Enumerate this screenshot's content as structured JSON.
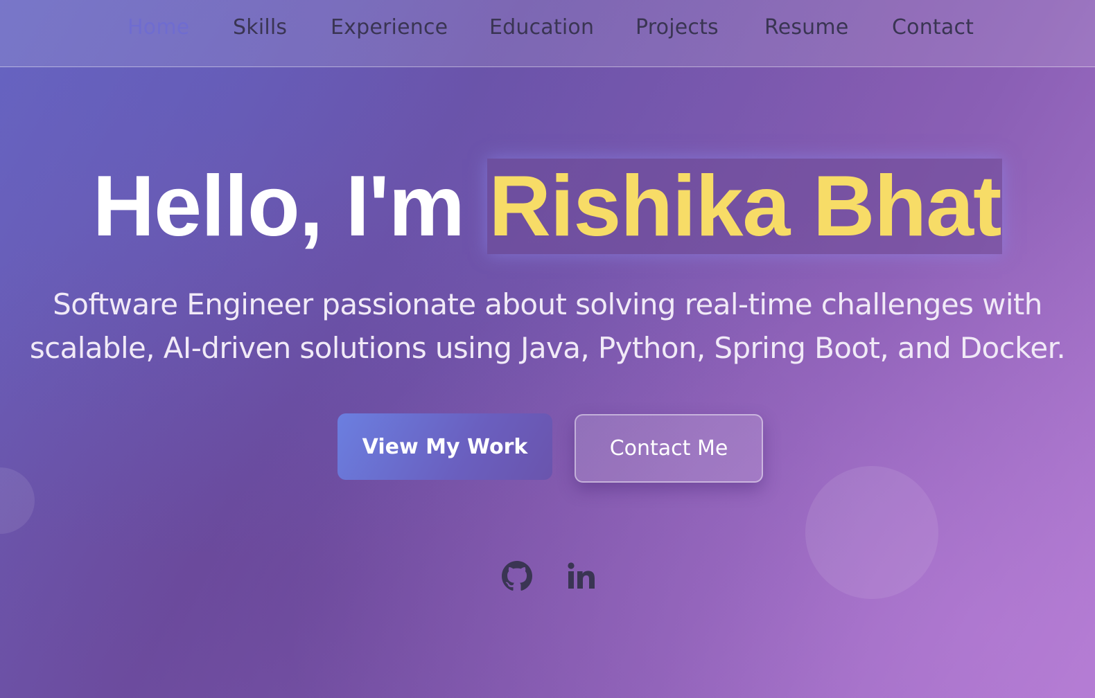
{
  "nav": {
    "items": [
      {
        "label": "Home",
        "active": true
      },
      {
        "label": "Skills",
        "active": false
      },
      {
        "label": "Experience",
        "active": false
      },
      {
        "label": "Education",
        "active": false
      },
      {
        "label": "Projects",
        "active": false
      },
      {
        "label": "Resume",
        "active": false
      },
      {
        "label": "Contact",
        "active": false
      }
    ]
  },
  "hero": {
    "greeting": "Hello, I'm ",
    "name": "Rishika Bhat",
    "subtitle": "Software Engineer passionate about solving real-time challenges with scalable, AI-driven solutions using Java, Python, Spring Boot, and Docker."
  },
  "buttons": {
    "primary": "View My Work",
    "secondary": "Contact Me"
  },
  "social": [
    {
      "icon": "github-icon"
    },
    {
      "icon": "linkedin-icon"
    }
  ],
  "colors": {
    "accent_name": "#f7dc67",
    "nav_active": "#6f6cd0",
    "nav_text": "#3a3553",
    "text_light": "#ffffff"
  }
}
